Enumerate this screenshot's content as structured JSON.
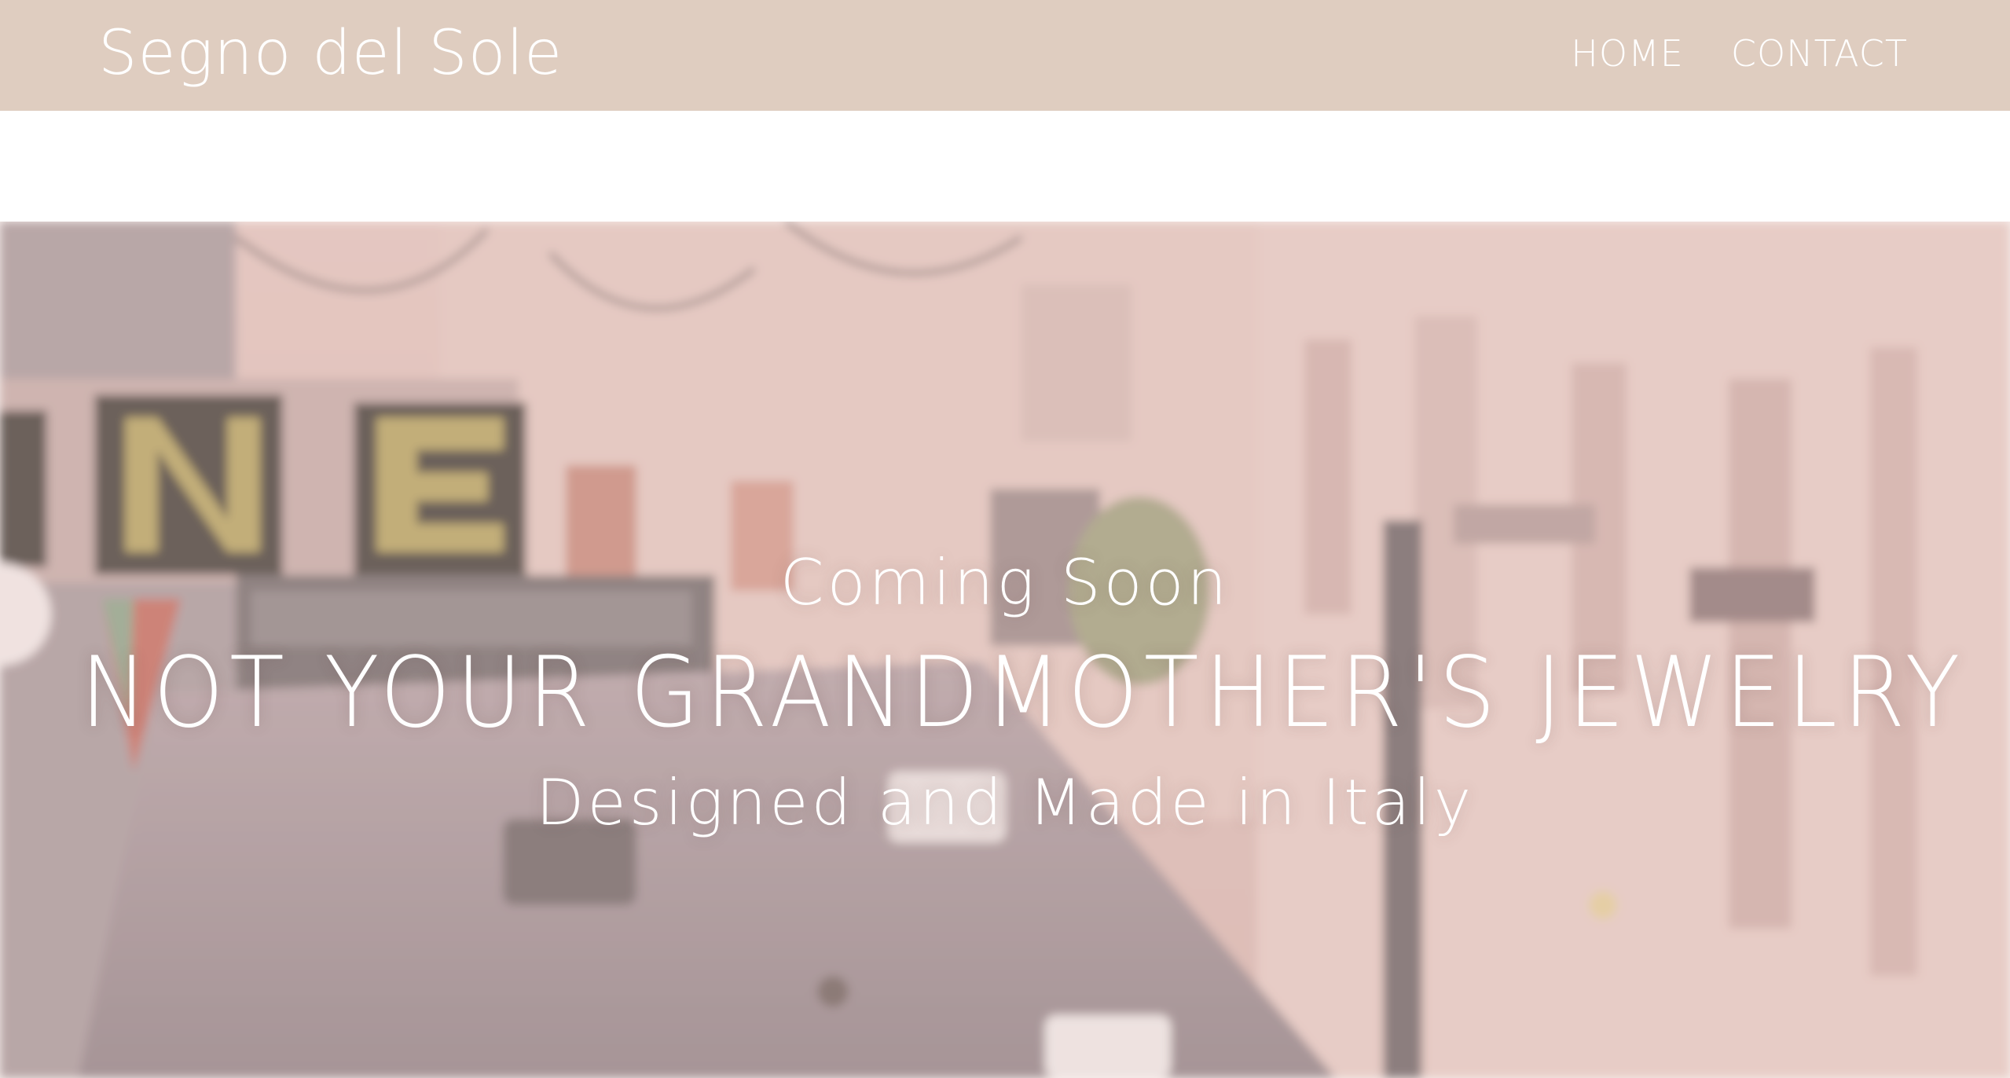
{
  "header": {
    "brand": "Segno del Sole",
    "nav": [
      {
        "label": "HOME"
      },
      {
        "label": "CONTACT"
      }
    ],
    "background_color": "#dfcdc0"
  },
  "hero": {
    "kicker": "Coming Soon",
    "headline": "NOT YOUR GRANDMOTHER'S JEWELRY",
    "tagline": "Designed and Made in Italy",
    "image_description_color": "#e7c6c0"
  }
}
